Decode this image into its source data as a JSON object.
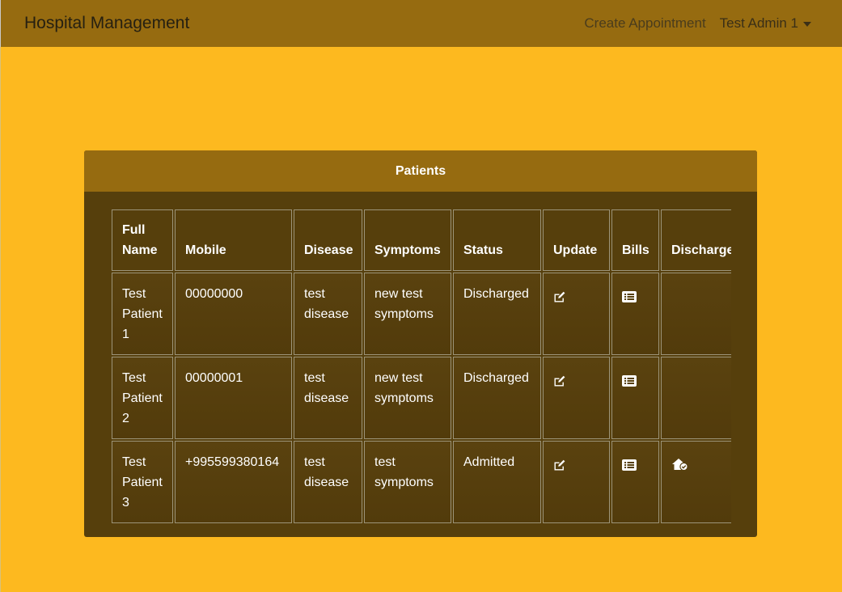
{
  "navbar": {
    "brand": "Hospital Management",
    "links": {
      "create_appointment": "Create Appointment",
      "user_menu": "Test Admin 1"
    }
  },
  "card": {
    "title": "Patients"
  },
  "table": {
    "headers": {
      "full_name": "Full Name",
      "mobile": "Mobile",
      "disease": "Disease",
      "symptoms": "Symptoms",
      "status": "Status",
      "update": "Update",
      "bills": "Bills",
      "discharge": "Discharge"
    },
    "rows": [
      {
        "full_name": "Test Patient 1",
        "mobile": "00000000",
        "disease": "test disease",
        "symptoms": "new test symptoms",
        "status": "Discharged",
        "update_icon": "edit-icon",
        "bills_icon": "list-icon",
        "discharge_icon": ""
      },
      {
        "full_name": "Test Patient 2",
        "mobile": "00000001",
        "disease": "test disease",
        "symptoms": "new test symptoms",
        "status": "Discharged",
        "update_icon": "edit-icon",
        "bills_icon": "list-icon",
        "discharge_icon": ""
      },
      {
        "full_name": "Test Patient 3",
        "mobile": "+995599380164",
        "disease": "test disease",
        "symptoms": "test symptoms",
        "status": "Admitted",
        "update_icon": "edit-icon",
        "bills_icon": "list-icon",
        "discharge_icon": "house-check-icon"
      }
    ]
  },
  "colors": {
    "page_bg": "#FDB91F",
    "navbar_bg": "#966B10",
    "card_bg": "#563F0C",
    "card_header_bg": "#966B10",
    "text_light": "#FFFFFF"
  }
}
